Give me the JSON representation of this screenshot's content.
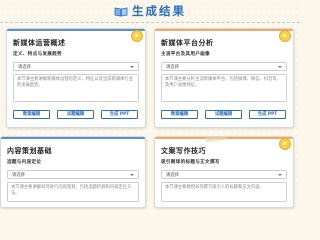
{
  "header": {
    "title": "生成结果",
    "icon": "book-icon"
  },
  "colors": {
    "accent": "#2b6fb8",
    "blue_bar": "#5b8fd0",
    "orange_bar": "#f0a86a",
    "pin": "#f6d24a"
  },
  "cards": [
    {
      "title": "新媒体运营概述",
      "label": "定义、特点与发展趋势",
      "select": "请选择",
      "text": "本节课主要讲解新媒体运营的定义，特征以及当前新媒体行业的发展趋势。",
      "buttons": [
        "教案编辑",
        "试题编辑",
        "生成 PPT"
      ]
    },
    {
      "title": "新媒体平台分析",
      "label": "主流平台及其用户画像",
      "select": "请选择",
      "text": "本节课主要分析主流新媒体平台，包括微博、微信、抖音等，及用户画像特征。",
      "buttons": [
        "教案编辑",
        "试题编辑",
        "生成 PPT"
      ]
    },
    {
      "title": "内容策划基础",
      "label": "选题与内容定位",
      "select": "请选择",
      "text": "本节课主要讲解如何进行内容策划，包括选题挖掘和内容定位方法。"
    },
    {
      "title": "文案写作技巧",
      "label": "吸引眼球的标题与正文撰写",
      "select": "请选择",
      "text": "本节课主要教授如何撰写吸引人的标题和正文内容。"
    }
  ]
}
